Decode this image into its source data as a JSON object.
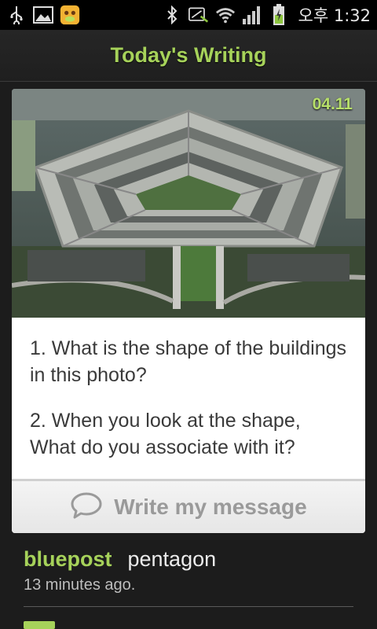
{
  "status_bar": {
    "time": "오후 1:32",
    "icons": [
      "usb-icon",
      "gallery-icon",
      "app-notification-icon",
      "bluetooth-icon",
      "mute-icon",
      "wifi-icon",
      "signal-icon",
      "battery-icon"
    ]
  },
  "header": {
    "title": "Today's Writing"
  },
  "card": {
    "date": "04.11",
    "questions": [
      "1. What is the shape of the buildings in this photo?",
      "2. When you look at the shape, What do you associate with it?"
    ],
    "write_button_label": "Write my message"
  },
  "comments": [
    {
      "user": "bluepost",
      "text": "pentagon",
      "time": "13 minutes ago."
    }
  ],
  "colors": {
    "accent": "#a6d25a",
    "background": "#1c1c1c",
    "card": "#ffffff"
  }
}
